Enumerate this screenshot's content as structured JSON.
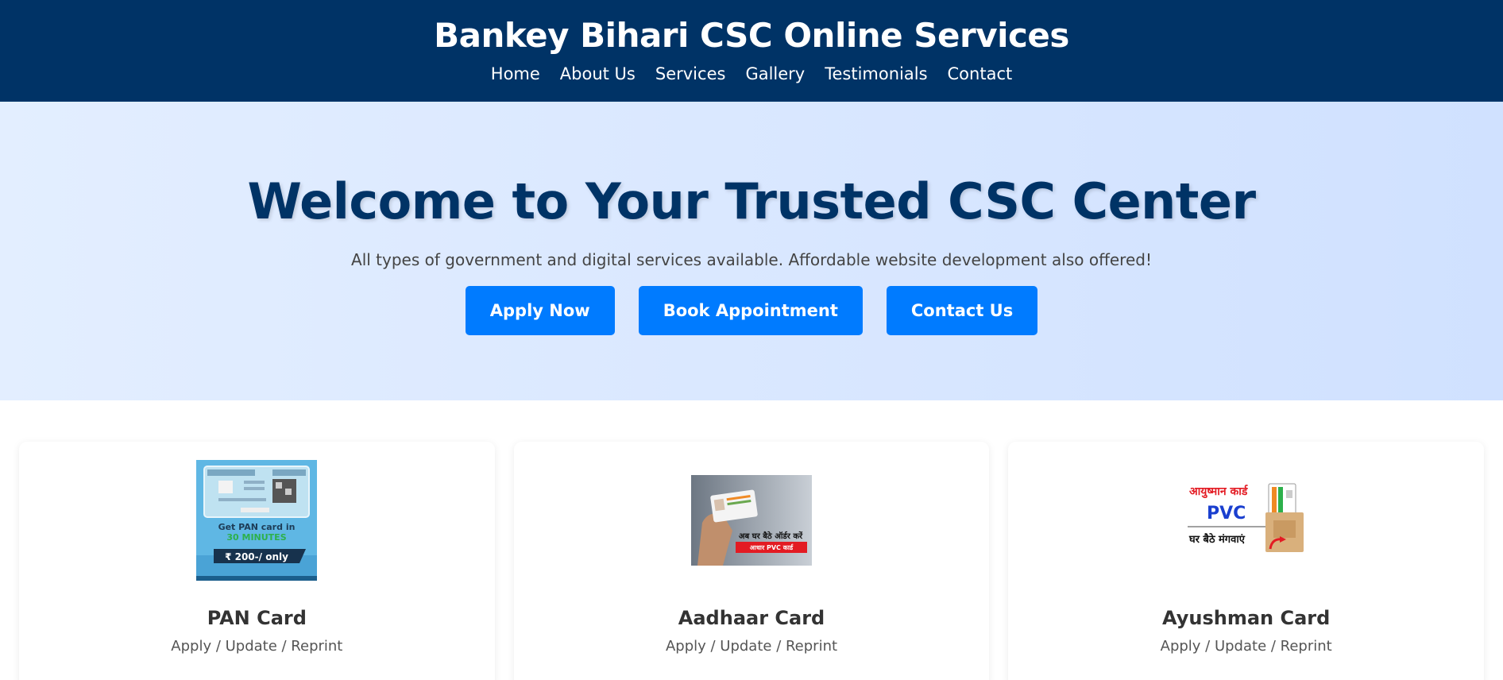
{
  "header": {
    "title": "Bankey Bihari CSC Online Services",
    "nav": [
      "Home",
      "About Us",
      "Services",
      "Gallery",
      "Testimonials",
      "Contact"
    ]
  },
  "hero": {
    "heading": "Welcome to Your Trusted CSC Center",
    "subtext": "All types of government and digital services available. Affordable website development also offered!",
    "buttons": [
      "Apply Now",
      "Book Appointment",
      "Contact Us"
    ]
  },
  "services": [
    {
      "title": "PAN Card",
      "desc": "Apply / Update / Reprint",
      "image_text": {
        "line1": "Get PAN card in",
        "line2": "30 MINUTES",
        "price": "₹ 200-/ only"
      }
    },
    {
      "title": "Aadhaar Card",
      "desc": "Apply / Update / Reprint",
      "image_text": {
        "line1": "अब घर बैठे ऑर्डर करें",
        "line2": "आधार PVC कार्ड"
      }
    },
    {
      "title": "Ayushman Card",
      "desc": "Apply / Update / Reprint",
      "image_text": {
        "line1": "आयुष्मान कार्ड",
        "line2": "PVC",
        "line3": "घर बैठे मंगवाएं"
      }
    }
  ],
  "colors": {
    "header_bg": "#003366",
    "accent": "#007bff",
    "heading": "#003366"
  }
}
